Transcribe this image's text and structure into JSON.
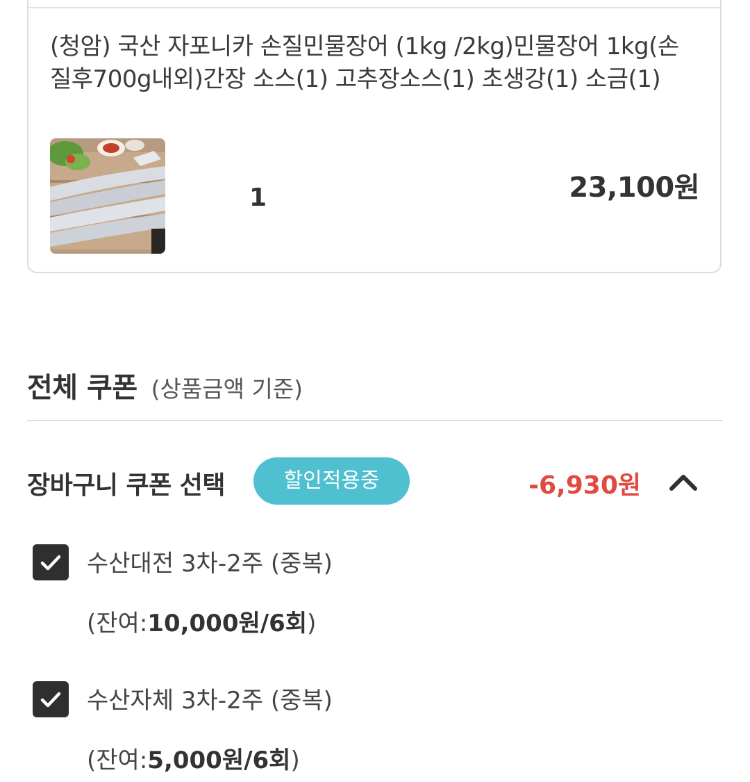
{
  "product": {
    "name": "(청암) 국산 자포니카 손질민물장어 (1kg /2kg)민물장어 1kg(손질후700g내외)간장 소스(1) 고추장소스(1) 초생강(1) 소금(1)",
    "quantity": "1",
    "price": "23,100원",
    "thumbnail_icon": "grilled-eel-photo"
  },
  "coupon_section": {
    "title": "전체 쿠폰",
    "subtitle": "(상품금액 기준)",
    "cart_coupon_label": "장바구니 쿠폰 선택",
    "badge_label": "할인적용중",
    "discount_amount": "-6,930원",
    "toggle_icon": "chevron-up-icon",
    "badge_color": "#4fc0d0",
    "discount_color": "#e04a3f"
  },
  "coupons": [
    {
      "name": "수산대전 3차-2주 (중복)",
      "remain_prefix": "(잔여:",
      "remain_value": "10,000원/6회",
      "remain_suffix": ")",
      "checked": true
    },
    {
      "name": "수산자체 3차-2주 (중복)",
      "remain_prefix": "(잔여:",
      "remain_value": "5,000원/6회",
      "remain_suffix": ")",
      "checked": true
    }
  ]
}
